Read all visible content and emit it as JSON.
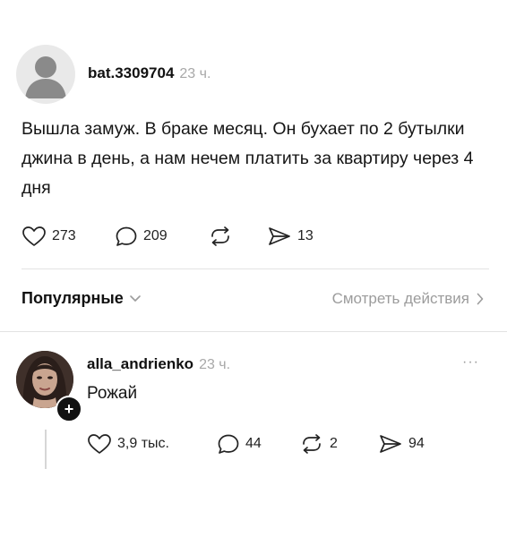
{
  "post": {
    "username": "bat.3309704",
    "time": "23 ч.",
    "text": "Вышла замуж. В браке месяц. Он бухает по 2 бутылки джина в день, а нам нечем платить за квартиру через 4 дня",
    "likes": "273",
    "comments": "209",
    "shares": "13"
  },
  "sort": {
    "label": "Популярные",
    "view_activity": "Смотреть действия"
  },
  "reply": {
    "username": "alla_andrienko",
    "time": "23 ч.",
    "more": "···",
    "text": "Рожай",
    "likes": "3,9 тыс.",
    "comments": "44",
    "reposts": "2",
    "shares": "94"
  },
  "colors": {
    "text": "#111111",
    "muted": "#a8a8a8",
    "divider": "#e3e3e3",
    "badge": "#111111"
  },
  "icons": [
    "heart-icon",
    "comment-icon",
    "repost-icon",
    "share-icon",
    "chevron-down-icon",
    "chevron-right-icon",
    "plus-icon",
    "more-icon"
  ]
}
